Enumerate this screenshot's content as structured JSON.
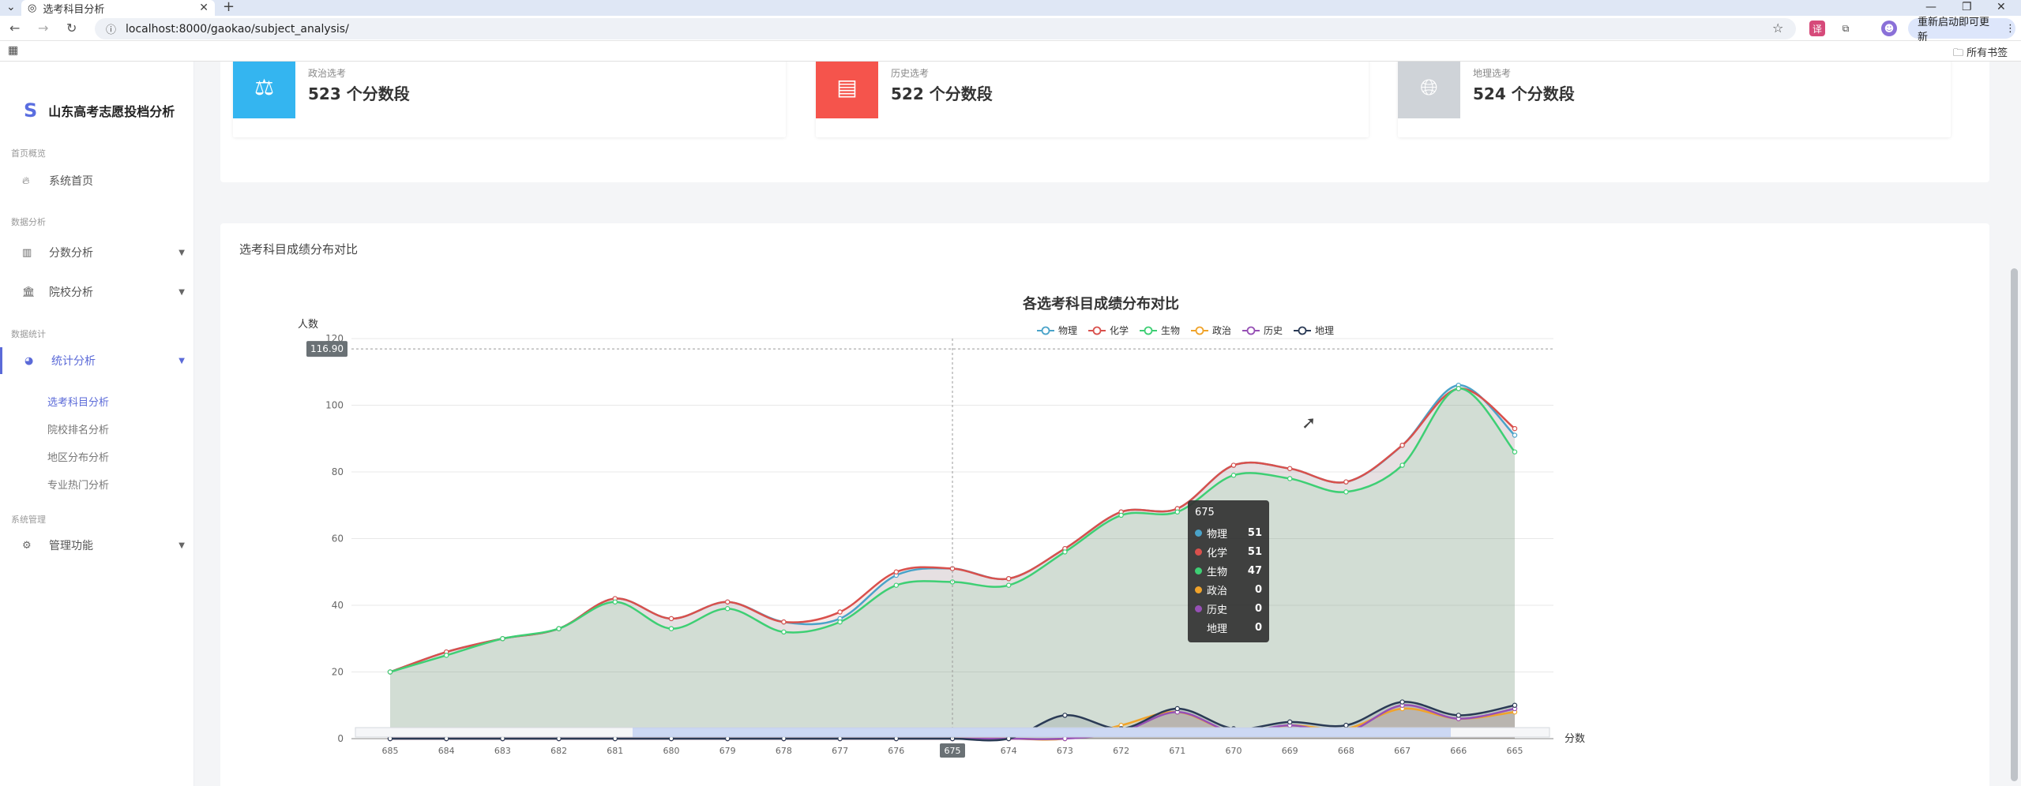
{
  "browser": {
    "tab_title": "选考科目分析",
    "tab_close": "✕",
    "new_tab": "+",
    "url": "localhost:8000/gaokao/subject_analysis/",
    "update_label": "重新启动即可更新",
    "bookmarks_label": "所有书签"
  },
  "sidebar": {
    "brand_logo": "S",
    "brand": "山东高考志愿投档分析",
    "groups": [
      "首页概览",
      "数据分析",
      "数据统计",
      "系统管理"
    ],
    "items": [
      {
        "label": "系统首页",
        "icon": "flame-icon"
      },
      {
        "label": "分数分析",
        "icon": "bar-chart-icon"
      },
      {
        "label": "院校分析",
        "icon": "building-icon"
      },
      {
        "label": "统计分析",
        "icon": "pie-chart-icon"
      },
      {
        "label": "管理功能",
        "icon": "gears-icon"
      }
    ],
    "sub_items": [
      "选考科目分析",
      "院校排名分析",
      "地区分布分析",
      "专业热门分析"
    ]
  },
  "stats": [
    {
      "label": "政治选考",
      "value": "523 个分数段",
      "color": "#34b5f0",
      "icon": "scale-icon"
    },
    {
      "label": "历史选考",
      "value": "522 个分数段",
      "color": "#f5544c",
      "icon": "book-icon"
    },
    {
      "label": "地理选考",
      "value": "524 个分数段",
      "color": "#cfd3d8",
      "icon": "globe-icon"
    }
  ],
  "card": {
    "title": "选考科目成绩分布对比"
  },
  "tooltip": {
    "title": "675",
    "rows": [
      {
        "name": "物理",
        "value": "51"
      },
      {
        "name": "化学",
        "value": "51"
      },
      {
        "name": "生物",
        "value": "47"
      },
      {
        "name": "政治",
        "value": "0"
      },
      {
        "name": "历史",
        "value": "0"
      },
      {
        "name": "地理",
        "value": "0"
      }
    ]
  },
  "chart_data": {
    "type": "area",
    "title": "各选考科目成绩分布对比",
    "xlabel": "分数",
    "ylabel": "人数",
    "x": [
      "685",
      "684",
      "683",
      "682",
      "681",
      "680",
      "679",
      "678",
      "677",
      "676",
      "675",
      "674",
      "673",
      "672",
      "671",
      "670",
      "669",
      "668",
      "667",
      "666",
      "665"
    ],
    "ylim": [
      0,
      120
    ],
    "yticks": [
      0,
      20,
      40,
      60,
      80,
      100,
      120
    ],
    "crosshair_value": "116.90",
    "highlight_x": "675",
    "legend_position": "top",
    "grid": true,
    "series": [
      {
        "name": "物理",
        "color": "#4aa3c9",
        "values": [
          20,
          26,
          30,
          33,
          42,
          36,
          41,
          35,
          36,
          49,
          51,
          48,
          57,
          68,
          69,
          82,
          81,
          77,
          88,
          106,
          91
        ]
      },
      {
        "name": "化学",
        "color": "#d9504c",
        "values": [
          20,
          26,
          30,
          33,
          42,
          36,
          41,
          35,
          38,
          50,
          51,
          48,
          57,
          68,
          69,
          82,
          81,
          77,
          88,
          105,
          93
        ]
      },
      {
        "name": "生物",
        "color": "#3ecf74",
        "values": [
          20,
          25,
          30,
          33,
          41,
          33,
          39,
          32,
          35,
          46,
          47,
          46,
          56,
          67,
          68,
          79,
          78,
          74,
          82,
          105,
          86
        ]
      },
      {
        "name": "政治",
        "color": "#f0a32a",
        "values": [
          0,
          0,
          0,
          0,
          0,
          0,
          0,
          0,
          0,
          0,
          0,
          0,
          0,
          4,
          8,
          2,
          4,
          3,
          9,
          6,
          8
        ]
      },
      {
        "name": "历史",
        "color": "#9650b5",
        "values": [
          0,
          0,
          0,
          0,
          0,
          0,
          0,
          0,
          0,
          0,
          0,
          0,
          0,
          2,
          8,
          2,
          4,
          2,
          10,
          6,
          9
        ]
      },
      {
        "name": "地理",
        "color": "#2a3a55",
        "values": [
          0,
          0,
          0,
          0,
          0,
          0,
          0,
          0,
          0,
          0,
          0,
          0,
          7,
          3,
          9,
          3,
          5,
          4,
          11,
          7,
          10
        ]
      }
    ]
  }
}
